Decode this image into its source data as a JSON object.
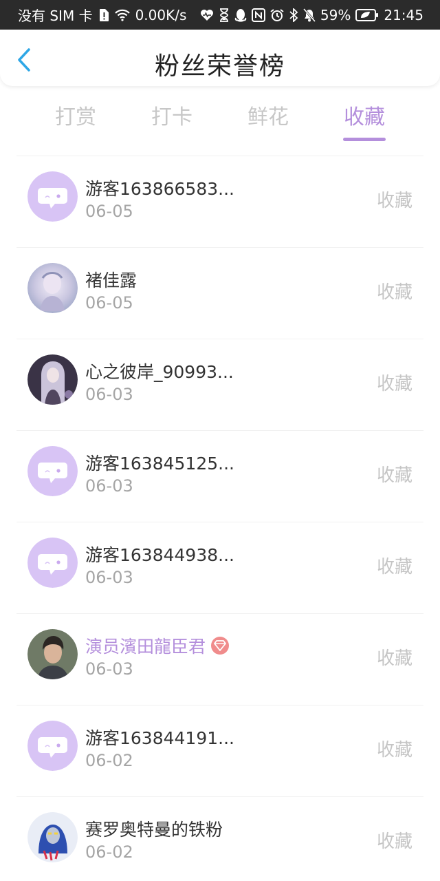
{
  "status_bar": {
    "carrier": "没有 SIM 卡",
    "speed": "0.00K/s",
    "battery": "59%",
    "time": "21:45",
    "icons": [
      "sim-alert-icon",
      "wifi-icon",
      "heart-icon",
      "hourglass-icon",
      "qq-icon",
      "nfc-icon",
      "alarm-icon",
      "bluetooth-icon",
      "mute-icon",
      "battery-icon"
    ]
  },
  "header": {
    "title": "粉丝荣誉榜",
    "back_icon": "chevron-left-icon"
  },
  "tabs": [
    {
      "label": "打赏",
      "active": false
    },
    {
      "label": "打卡",
      "active": false
    },
    {
      "label": "鲜花",
      "active": false
    },
    {
      "label": "收藏",
      "active": true
    }
  ],
  "colors": {
    "accent": "#b48fdc",
    "avatar_placeholder": "#d8c4f5",
    "badge": "#f08c8c"
  },
  "fans": [
    {
      "name": "游客163866583...",
      "date": "06-05",
      "action": "收藏",
      "avatar": "chat-bubble-placeholder"
    },
    {
      "name": "褚佳露",
      "date": "06-05",
      "action": "收藏",
      "avatar": "photo"
    },
    {
      "name": "心之彼岸_90993...",
      "date": "06-03",
      "action": "收藏",
      "avatar": "photo"
    },
    {
      "name": "游客163845125...",
      "date": "06-03",
      "action": "收藏",
      "avatar": "chat-bubble-placeholder"
    },
    {
      "name": "游客163844938...",
      "date": "06-03",
      "action": "收藏",
      "avatar": "chat-bubble-placeholder"
    },
    {
      "name": "演员濱田龍臣君",
      "date": "06-03",
      "action": "收藏",
      "avatar": "photo",
      "vip": true,
      "badge_icon": "diamond-badge-icon"
    },
    {
      "name": "游客163844191...",
      "date": "06-02",
      "action": "收藏",
      "avatar": "chat-bubble-placeholder"
    },
    {
      "name": "赛罗奥特曼的铁粉",
      "date": "06-02",
      "action": "收藏",
      "avatar": "photo"
    }
  ]
}
